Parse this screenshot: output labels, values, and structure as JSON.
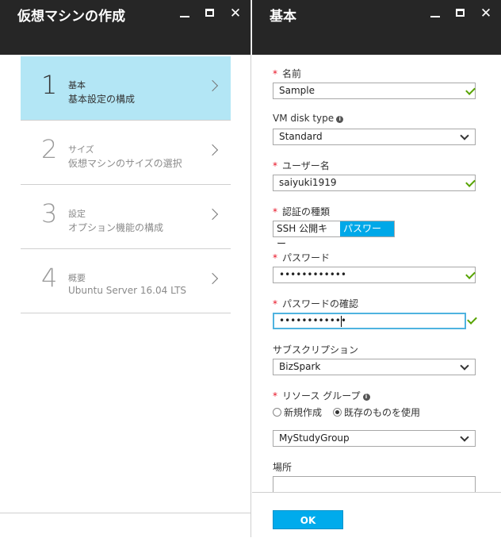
{
  "blade1": {
    "title": "仮想マシンの作成",
    "steps": [
      {
        "number": "1",
        "title": "基本",
        "subtitle": "基本設定の構成"
      },
      {
        "number": "2",
        "title": "サイズ",
        "subtitle": "仮想マシンのサイズの選択"
      },
      {
        "number": "3",
        "title": "設定",
        "subtitle": "オプション機能の構成"
      },
      {
        "number": "4",
        "title": "概要",
        "subtitle": "Ubuntu Server 16.04 LTS"
      }
    ]
  },
  "blade2": {
    "title": "基本",
    "name": {
      "label": "名前",
      "value": "Sample"
    },
    "disk_type": {
      "label": "VM disk type",
      "value": "Standard"
    },
    "user": {
      "label": "ユーザー名",
      "value": "saiyuki1919"
    },
    "auth": {
      "label": "認証の種類",
      "options": [
        "SSH 公開キー",
        "パスワード"
      ],
      "selected": "パスワード"
    },
    "password": {
      "label": "パスワード",
      "value": "••••••••••••"
    },
    "confirm": {
      "label": "パスワードの確認",
      "value": "••••••••••••"
    },
    "subscription": {
      "label": "サブスクリプション",
      "value": "BizSpark"
    },
    "resource_group": {
      "label": "リソース グループ",
      "radio_new": "新規作成",
      "radio_existing": "既存のものを使用",
      "value": "MyStudyGroup"
    },
    "location": {
      "label": "場所"
    },
    "ok_label": "OK"
  },
  "colors": {
    "header": "#262626",
    "accent": "#00abec",
    "active_step": "#b3e6f5",
    "check": "#57a300",
    "required": "#e81123"
  }
}
